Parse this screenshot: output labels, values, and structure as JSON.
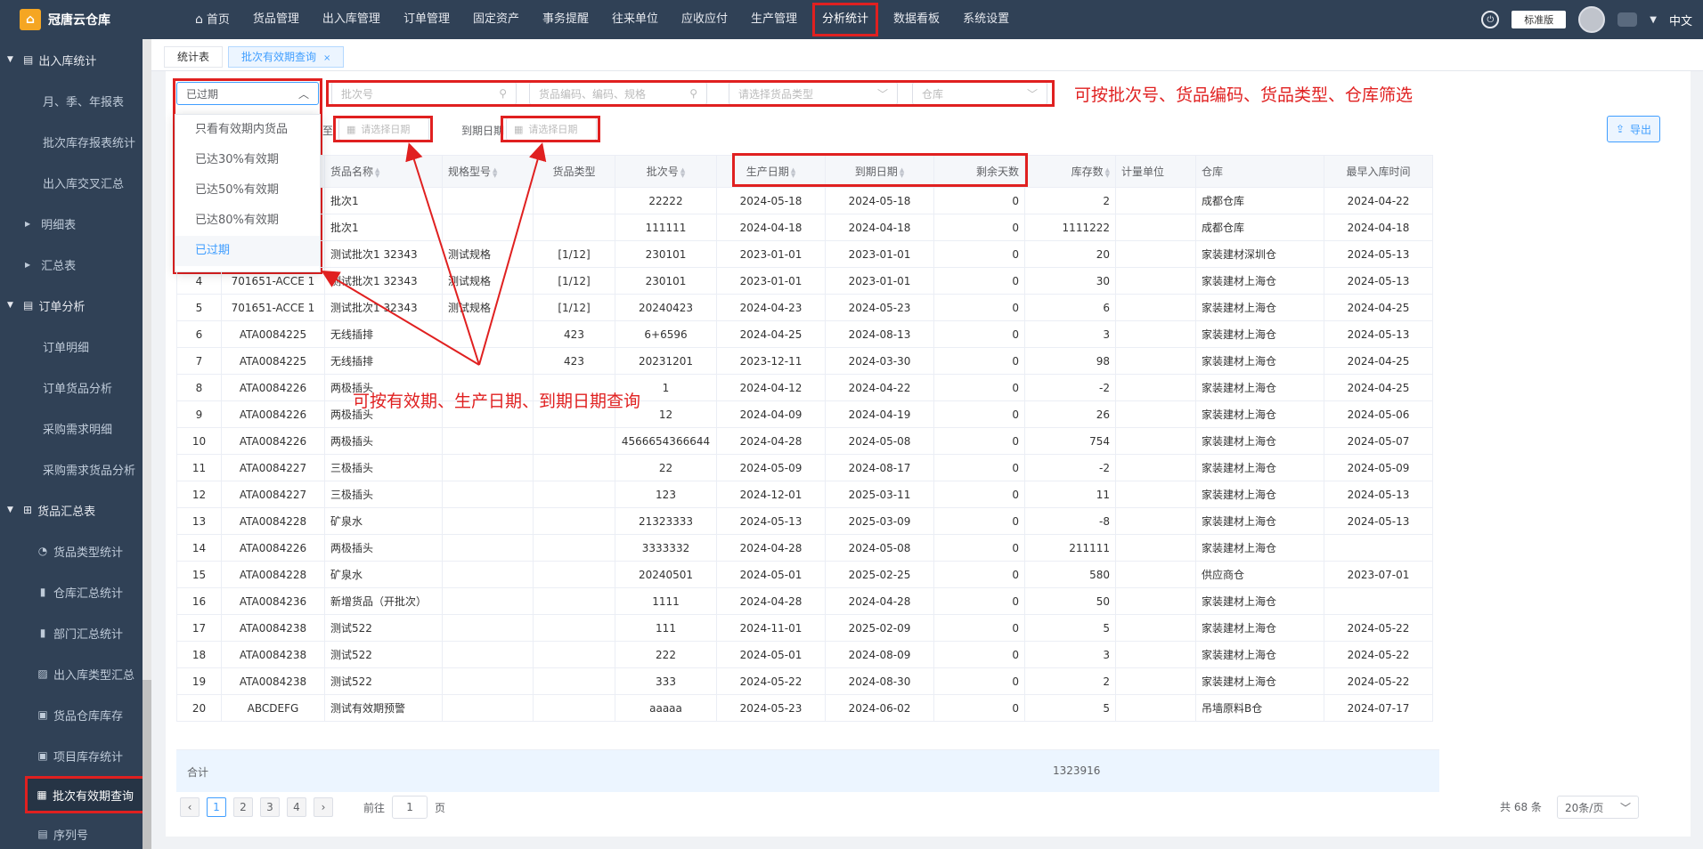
{
  "app": {
    "name": "冠唐云仓库",
    "logo_icon": "logo-icon"
  },
  "topnav": {
    "items": [
      {
        "label": "首页",
        "icon": "home-icon"
      },
      {
        "label": "货品管理"
      },
      {
        "label": "出入库管理"
      },
      {
        "label": "订单管理"
      },
      {
        "label": "固定资产"
      },
      {
        "label": "事务提醒"
      },
      {
        "label": "往来单位"
      },
      {
        "label": "应收应付"
      },
      {
        "label": "生产管理"
      },
      {
        "label": "分析统计",
        "active": true
      },
      {
        "label": "数据看板"
      },
      {
        "label": "系统设置"
      }
    ],
    "edition": "标准版",
    "language": "中文"
  },
  "sidebar": {
    "items": [
      {
        "type": "top",
        "label": "出入库统计",
        "icon": "inout-icon"
      },
      {
        "type": "sub",
        "label": "月、季、年报表"
      },
      {
        "type": "sub",
        "label": "批次库存报表统计"
      },
      {
        "type": "sub",
        "label": "出入库交叉汇总"
      },
      {
        "type": "grp",
        "label": "明细表"
      },
      {
        "type": "grp",
        "label": "汇总表"
      },
      {
        "type": "top",
        "label": "订单分析",
        "icon": "cart-icon"
      },
      {
        "type": "sub",
        "label": "订单明细"
      },
      {
        "type": "sub",
        "label": "订单货品分析"
      },
      {
        "type": "sub",
        "label": "采购需求明细"
      },
      {
        "type": "sub",
        "label": "采购需求货品分析"
      },
      {
        "type": "top",
        "label": "货品汇总表",
        "icon": "goods-icon"
      },
      {
        "type": "sub2",
        "label": "货品类型统计",
        "icon": "pie-icon"
      },
      {
        "type": "sub2",
        "label": "仓库汇总统计",
        "icon": "bar-icon"
      },
      {
        "type": "sub2",
        "label": "部门汇总统计",
        "icon": "bar-icon"
      },
      {
        "type": "sub2",
        "label": "出入库类型汇总",
        "icon": "chart-icon"
      },
      {
        "type": "sub2",
        "label": "货品仓库库存",
        "icon": "box-icon"
      },
      {
        "type": "sub2",
        "label": "项目库存统计",
        "icon": "box-icon"
      },
      {
        "type": "sub2",
        "label": "批次有效期查询",
        "icon": "grid-icon",
        "active": true
      },
      {
        "type": "sub2",
        "label": "序列号",
        "icon": "list-icon"
      }
    ]
  },
  "tabs": [
    {
      "label": "统计表"
    },
    {
      "label": "批次有效期查询",
      "active": true,
      "close": "×"
    }
  ],
  "filters": {
    "expiry_select": "已过期",
    "batch_placeholder": "批次号",
    "goods_placeholder": "货品编码、编码、规格",
    "type_placeholder": "请选择货品类型",
    "warehouse_placeholder": "仓库",
    "prod_to_label": "至",
    "prod_date_placeholder": "请选择日期",
    "due_label": "到期日期",
    "due_date_placeholder": "请选择日期",
    "export_label": "导出"
  },
  "dropdown": {
    "options": [
      "只看有效期内货品",
      "已达30%有效期",
      "已达50%有效期",
      "已达80%有效期",
      "已过期"
    ],
    "selected": "已过期"
  },
  "annotations": {
    "top": "可按批次号、货品编码、货品类型、仓库筛选",
    "middle": "可按有效期、生产日期、到期日期查询"
  },
  "table": {
    "columns": [
      "",
      "",
      "货品名称",
      "规格型号",
      "货品类型",
      "批次号",
      "生产日期",
      "到期日期",
      "剩余天数",
      "库存数",
      "计量单位",
      "仓库",
      "最早入库时间"
    ],
    "rows": [
      [
        "",
        "",
        "批次1",
        "",
        "",
        "22222",
        "2024-05-18",
        "2024-05-18",
        "0",
        "2",
        "",
        "成都仓库",
        "2024-04-22"
      ],
      [
        "",
        "",
        "批次1",
        "",
        "",
        "111111",
        "2024-04-18",
        "2024-04-18",
        "0",
        "1111222",
        "",
        "成都仓库",
        "2024-04-18"
      ],
      [
        "",
        "",
        "测试批次1 32343",
        "测试规格",
        "[1/12]",
        "230101",
        "2023-01-01",
        "2023-01-01",
        "0",
        "20",
        "",
        "家装建材深圳仓",
        "2024-05-13"
      ],
      [
        "4",
        "701651-ACCE 1",
        "测试批次1 32343",
        "测试规格",
        "[1/12]",
        "230101",
        "2023-01-01",
        "2023-01-01",
        "0",
        "30",
        "",
        "家装建材上海仓",
        "2024-05-13"
      ],
      [
        "5",
        "701651-ACCE 1",
        "测试批次1 32343",
        "测试规格",
        "[1/12]",
        "20240423",
        "2024-04-23",
        "2024-05-23",
        "0",
        "6",
        "",
        "家装建材上海仓",
        "2024-04-25"
      ],
      [
        "6",
        "ATA0084225",
        "无线插排",
        "",
        "423",
        "6+6596",
        "2024-04-25",
        "2024-08-13",
        "0",
        "3",
        "",
        "家装建材上海仓",
        "2024-05-13"
      ],
      [
        "7",
        "ATA0084225",
        "无线插排",
        "",
        "423",
        "20231201",
        "2023-12-11",
        "2024-03-30",
        "0",
        "98",
        "",
        "家装建材上海仓",
        "2024-04-25"
      ],
      [
        "8",
        "ATA0084226",
        "两极插头",
        "",
        "",
        "1",
        "2024-04-12",
        "2024-04-22",
        "0",
        "-2",
        "",
        "家装建材上海仓",
        "2024-04-25"
      ],
      [
        "9",
        "ATA0084226",
        "两极插头",
        "",
        "",
        "12",
        "2024-04-09",
        "2024-04-19",
        "0",
        "26",
        "",
        "家装建材上海仓",
        "2024-05-06"
      ],
      [
        "10",
        "ATA0084226",
        "两极插头",
        "",
        "",
        "4566654366644",
        "2024-04-28",
        "2024-05-08",
        "0",
        "754",
        "",
        "家装建材上海仓",
        "2024-05-07"
      ],
      [
        "11",
        "ATA0084227",
        "三极插头",
        "",
        "",
        "22",
        "2024-05-09",
        "2024-08-17",
        "0",
        "-2",
        "",
        "家装建材上海仓",
        "2024-05-09"
      ],
      [
        "12",
        "ATA0084227",
        "三极插头",
        "",
        "",
        "123",
        "2024-12-01",
        "2025-03-11",
        "0",
        "11",
        "",
        "家装建材上海仓",
        "2024-05-13"
      ],
      [
        "13",
        "ATA0084228",
        "矿泉水",
        "",
        "",
        "21323333",
        "2024-05-13",
        "2025-03-09",
        "0",
        "-8",
        "",
        "家装建材上海仓",
        "2024-05-13"
      ],
      [
        "14",
        "ATA0084226",
        "两极插头",
        "",
        "",
        "3333332",
        "2024-04-28",
        "2024-05-08",
        "0",
        "211111",
        "",
        "家装建材上海仓",
        ""
      ],
      [
        "15",
        "ATA0084228",
        "矿泉水",
        "",
        "",
        "20240501",
        "2024-05-01",
        "2025-02-25",
        "0",
        "580",
        "",
        "供应商仓",
        "2023-07-01"
      ],
      [
        "16",
        "ATA0084236",
        "新增货品（开批次）",
        "",
        "",
        "1111",
        "2024-04-28",
        "2024-04-28",
        "0",
        "50",
        "",
        "家装建材上海仓",
        ""
      ],
      [
        "17",
        "ATA0084238",
        "测试522",
        "",
        "",
        "111",
        "2024-11-01",
        "2025-02-09",
        "0",
        "5",
        "",
        "家装建材上海仓",
        "2024-05-22"
      ],
      [
        "18",
        "ATA0084238",
        "测试522",
        "",
        "",
        "222",
        "2024-05-01",
        "2024-08-09",
        "0",
        "3",
        "",
        "家装建材上海仓",
        "2024-05-22"
      ],
      [
        "19",
        "ATA0084238",
        "测试522",
        "",
        "",
        "333",
        "2024-05-22",
        "2024-08-30",
        "0",
        "2",
        "",
        "家装建材上海仓",
        "2024-05-22"
      ],
      [
        "20",
        "ABCDEFG",
        "测试有效期预警",
        "",
        "",
        "aaaaa",
        "2024-05-23",
        "2024-06-02",
        "0",
        "5",
        "",
        "吊墙原料B仓",
        "2024-07-17"
      ]
    ],
    "sum_label": "合计",
    "sum_value": "1323916"
  },
  "pagination": {
    "pages": [
      "1",
      "2",
      "3",
      "4"
    ],
    "current": "1",
    "goto_label": "前往",
    "goto_value": "1",
    "page_unit": "页",
    "total": "共 68 条",
    "page_size": "20条/页"
  },
  "colors": {
    "accent": "#409eff",
    "annotation": "#e02020",
    "topbar": "#304156"
  }
}
